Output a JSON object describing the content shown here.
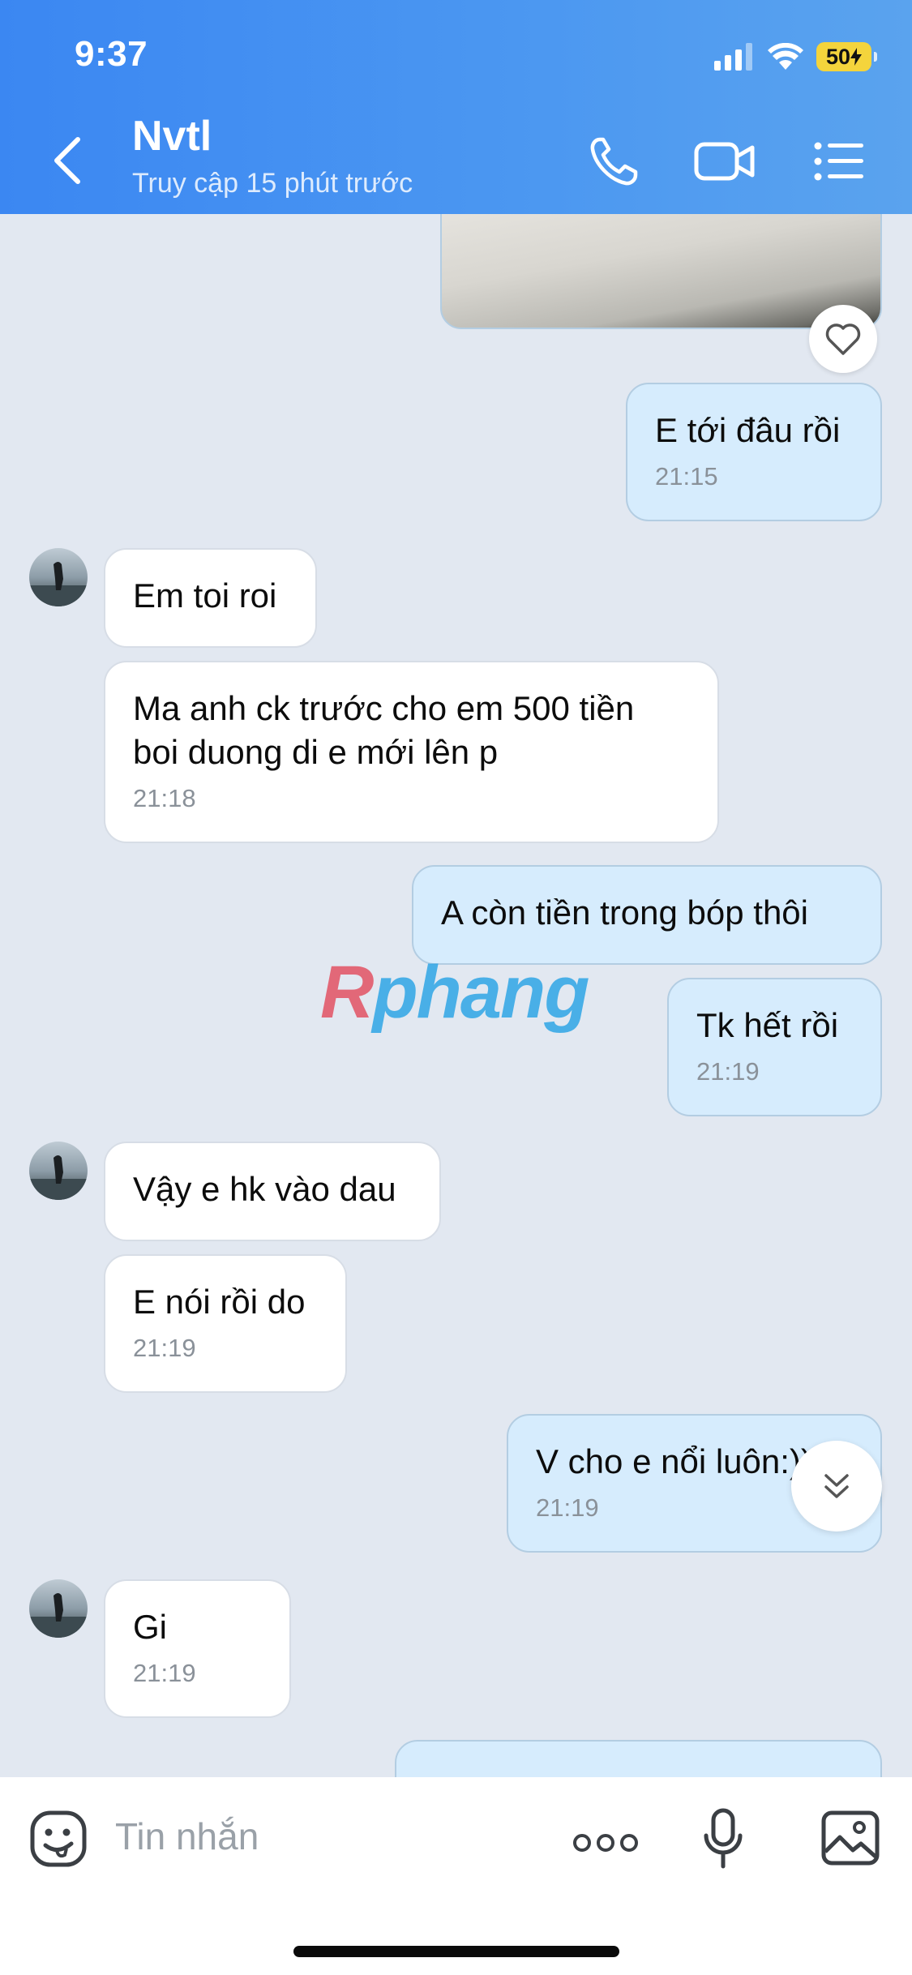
{
  "status_bar": {
    "time": "9:37",
    "battery": "50"
  },
  "header": {
    "contact_name": "Nvtl",
    "contact_status": "Truy cập 15 phút trước"
  },
  "messages": [
    {
      "side": "out",
      "text": "E tới đâu rồi",
      "time": "21:15"
    },
    {
      "side": "in",
      "text": "Em toi roi",
      "time": ""
    },
    {
      "side": "in",
      "text": "Ma anh ck trước cho em 500 tiền\nboi duong di e mới lên p",
      "time": "21:18"
    },
    {
      "side": "out",
      "text": "A còn tiền trong bóp thôi",
      "time": ""
    },
    {
      "side": "out",
      "text": "Tk hết rồi",
      "time": "21:19"
    },
    {
      "side": "in",
      "text": "Vậy e hk vào dau",
      "time": ""
    },
    {
      "side": "in",
      "text": "E nói rồi do",
      "time": "21:19"
    },
    {
      "side": "out",
      "text": "V cho e nổi luôn:)))",
      "time": "21:19"
    },
    {
      "side": "in",
      "text": "Gi",
      "time": "21:19"
    }
  ],
  "watermark": {
    "first": "R",
    "rest": "phang"
  },
  "input": {
    "placeholder": "Tin nhắn"
  },
  "icons": [
    "back-icon",
    "phone-icon",
    "video-call-icon",
    "list-menu-icon",
    "heart-icon",
    "scroll-down-icon",
    "emoji-sticker-icon",
    "more-icon",
    "microphone-icon",
    "image-icon"
  ]
}
